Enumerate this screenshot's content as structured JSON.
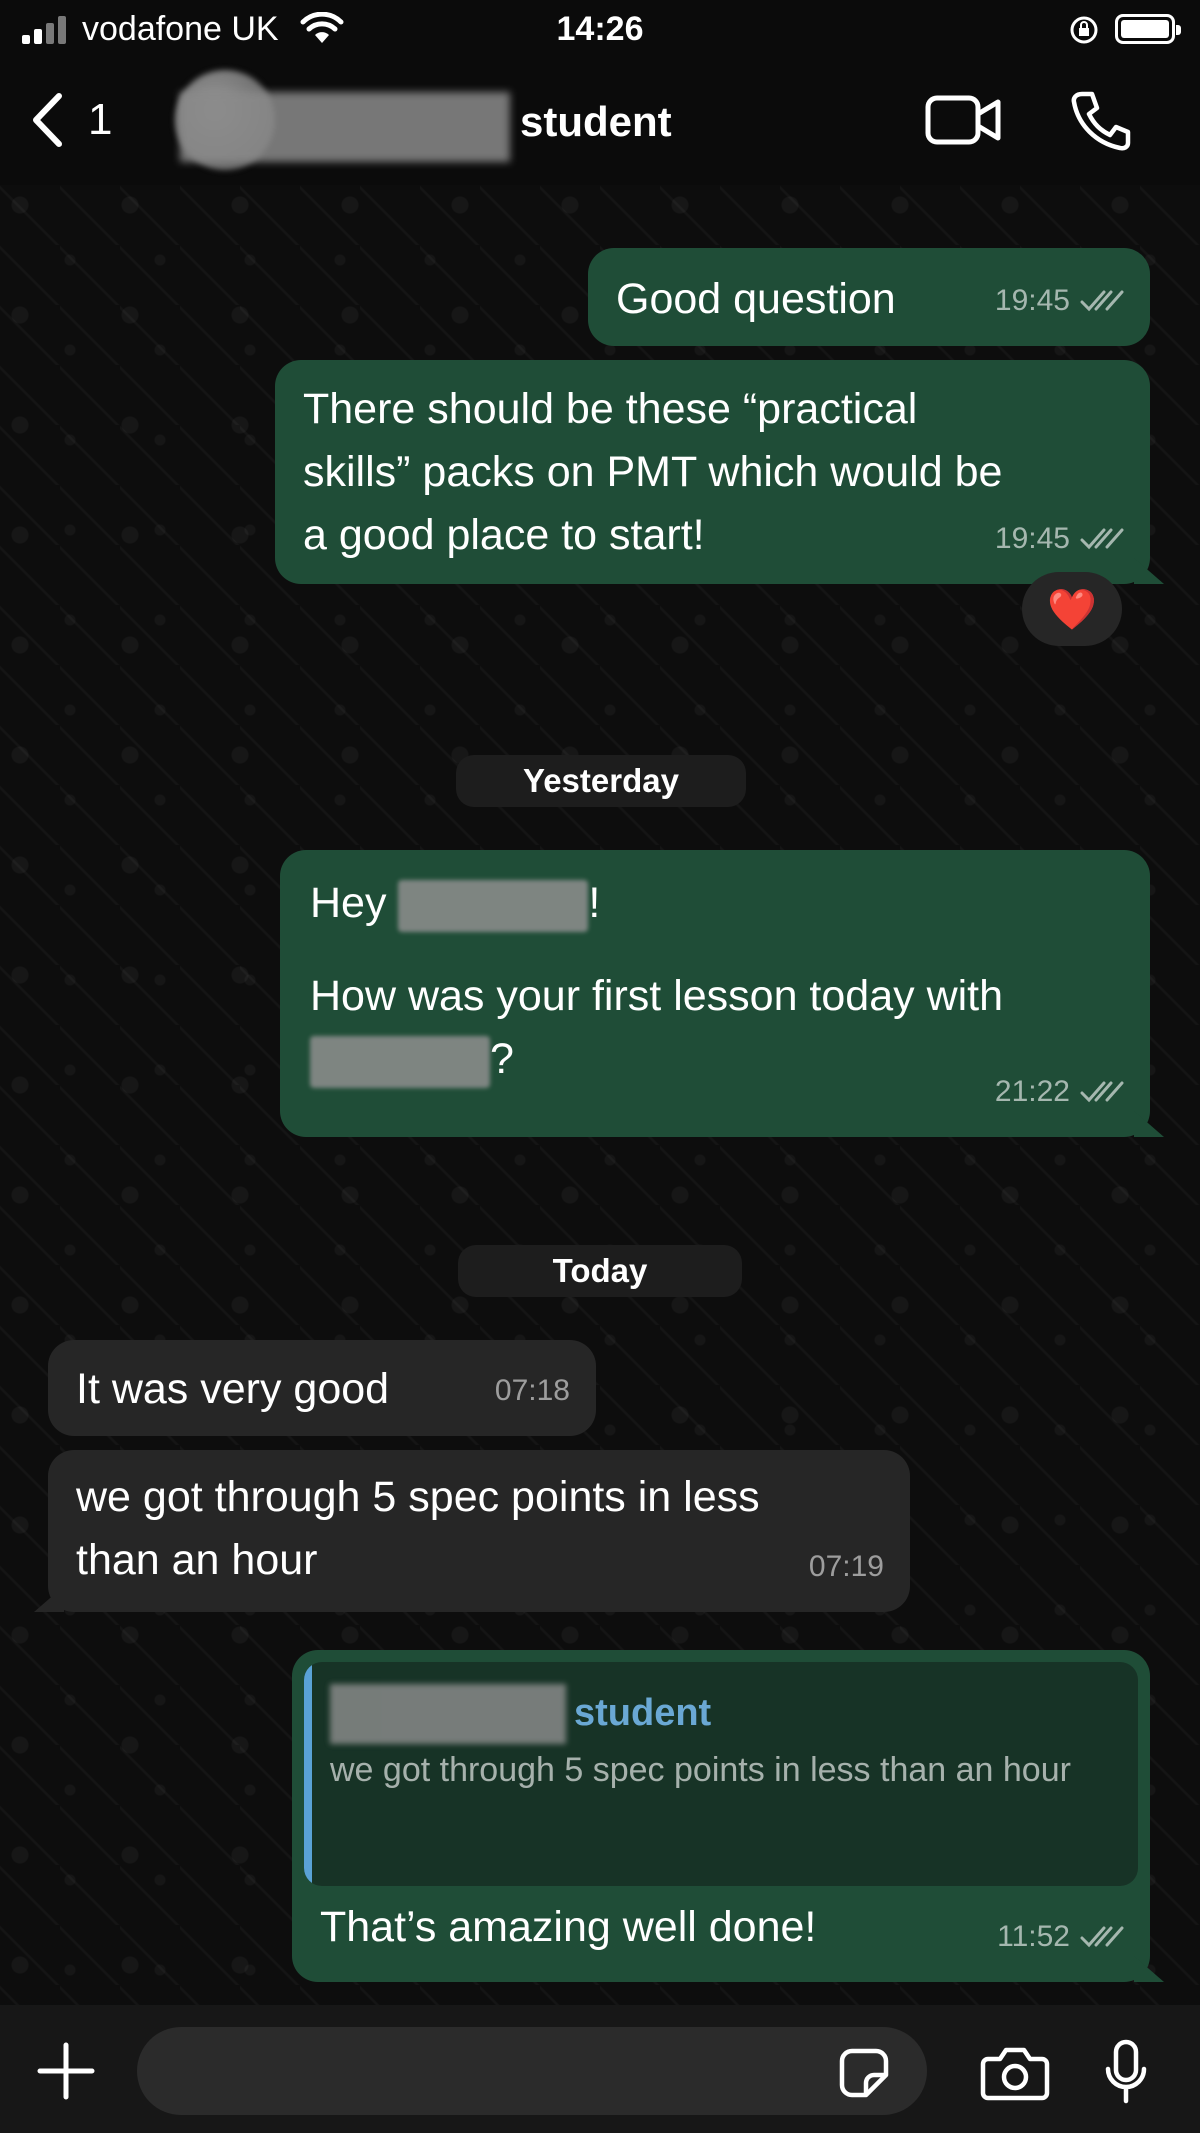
{
  "status_bar": {
    "carrier": "vodafone UK",
    "time": "14:26"
  },
  "header": {
    "back_count": "1",
    "contact_name": "student"
  },
  "messages": [
    {
      "direction": "out",
      "text": "Good question",
      "time": "19:45"
    },
    {
      "direction": "out",
      "text": "There should be these “practical\nskills” packs on PMT which would be\na good place to start!",
      "time": "19:45",
      "reaction": "❤️"
    },
    {
      "direction": "out",
      "text_prefix": "Hey ",
      "text_suffix": "!",
      "text_body": "How was your first lesson today with",
      "text_end": "?",
      "time": "21:22"
    },
    {
      "direction": "in",
      "text": "It was very good",
      "time": "07:18"
    },
    {
      "direction": "in",
      "text": "we got through 5 spec points in less\nthan an hour",
      "time": "07:19"
    },
    {
      "direction": "out",
      "quote_author": "student",
      "quote_text": "we got through 5 spec points in less than an hour",
      "text": "That’s amazing well done!",
      "time": "11:52"
    }
  ],
  "date_separators": {
    "yesterday": "Yesterday",
    "today": "Today"
  },
  "colors": {
    "outgoing_bubble": "#1f4d37",
    "incoming_bubble": "#262626",
    "quote_accent": "#5aa2d6"
  },
  "icons": [
    "back-chevron-icon",
    "video-call-icon",
    "phone-icon",
    "plus-icon",
    "sticker-icon",
    "camera-icon",
    "microphone-icon",
    "double-check-icon",
    "heart-icon"
  ]
}
